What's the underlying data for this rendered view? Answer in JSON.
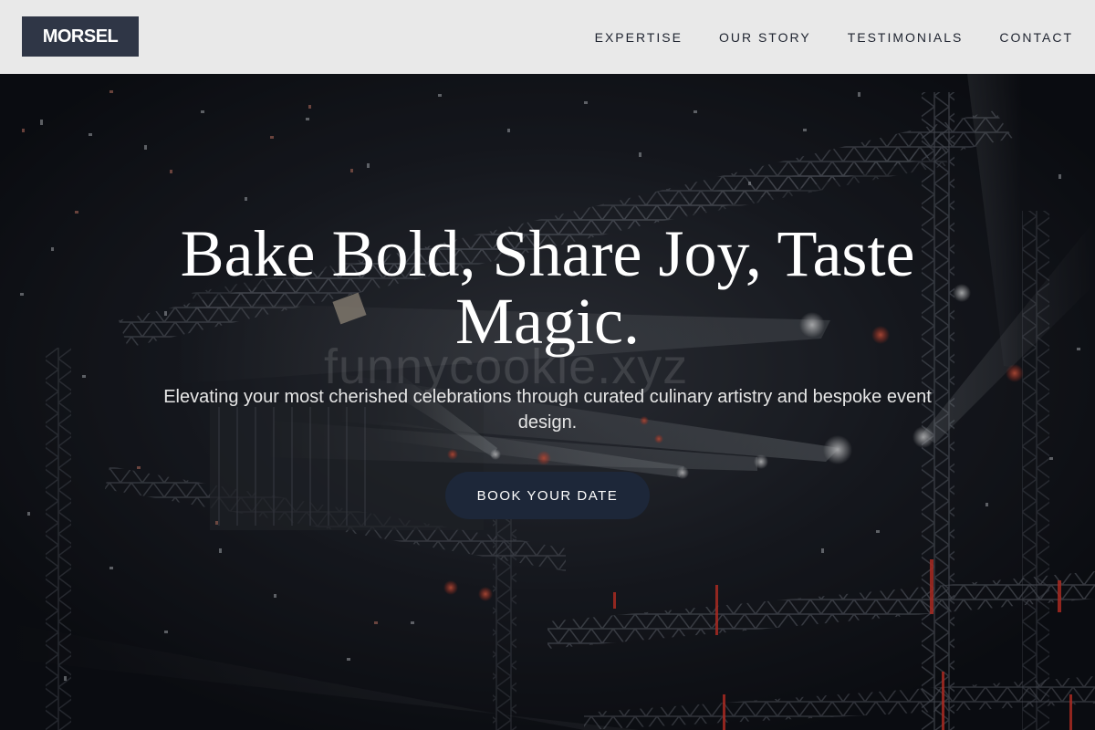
{
  "header": {
    "logo_text": "MORSEL",
    "nav": [
      {
        "label": "EXPERTISE"
      },
      {
        "label": "OUR STORY"
      },
      {
        "label": "TESTIMONIALS"
      },
      {
        "label": "CONTACT"
      }
    ]
  },
  "hero": {
    "title": "Bake Bold, Share Joy, Taste Magic.",
    "subtitle": "Elevating your most cherished celebrations through curated culinary artistry and bespoke event design.",
    "cta_label": "BOOK YOUR DATE",
    "watermark": "funnycookie.xyz",
    "background_image": "concert-stage-lighting-truss-confetti"
  },
  "colors": {
    "navbar_bg": "#e9e9e9",
    "logo_bg": "#2f3646",
    "nav_text": "#1f2430",
    "cta_bg": "#1d2739",
    "hero_text": "#ffffff"
  }
}
